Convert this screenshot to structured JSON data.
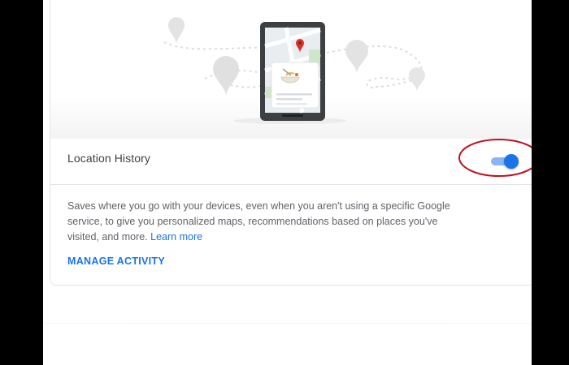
{
  "setting": {
    "label": "Location History",
    "enabled": true
  },
  "description": {
    "text": "Saves where you go with your devices, even when you aren't using a specific Google service, to give you personalized maps, recommendations based on places you've visited, and more.",
    "learn_more": "Learn more"
  },
  "actions": {
    "manage_label": "MANAGE ACTIVITY"
  },
  "colors": {
    "accent": "#1a73e8",
    "toggle_track": "#8ab4f8",
    "annotation": "#c0111f",
    "label_text": "#3c4043",
    "body_text": "#5f6368"
  },
  "icons": [
    "phone-map-illustration",
    "location-pin-icon",
    "food-bowl-icon",
    "toggle-switch"
  ]
}
